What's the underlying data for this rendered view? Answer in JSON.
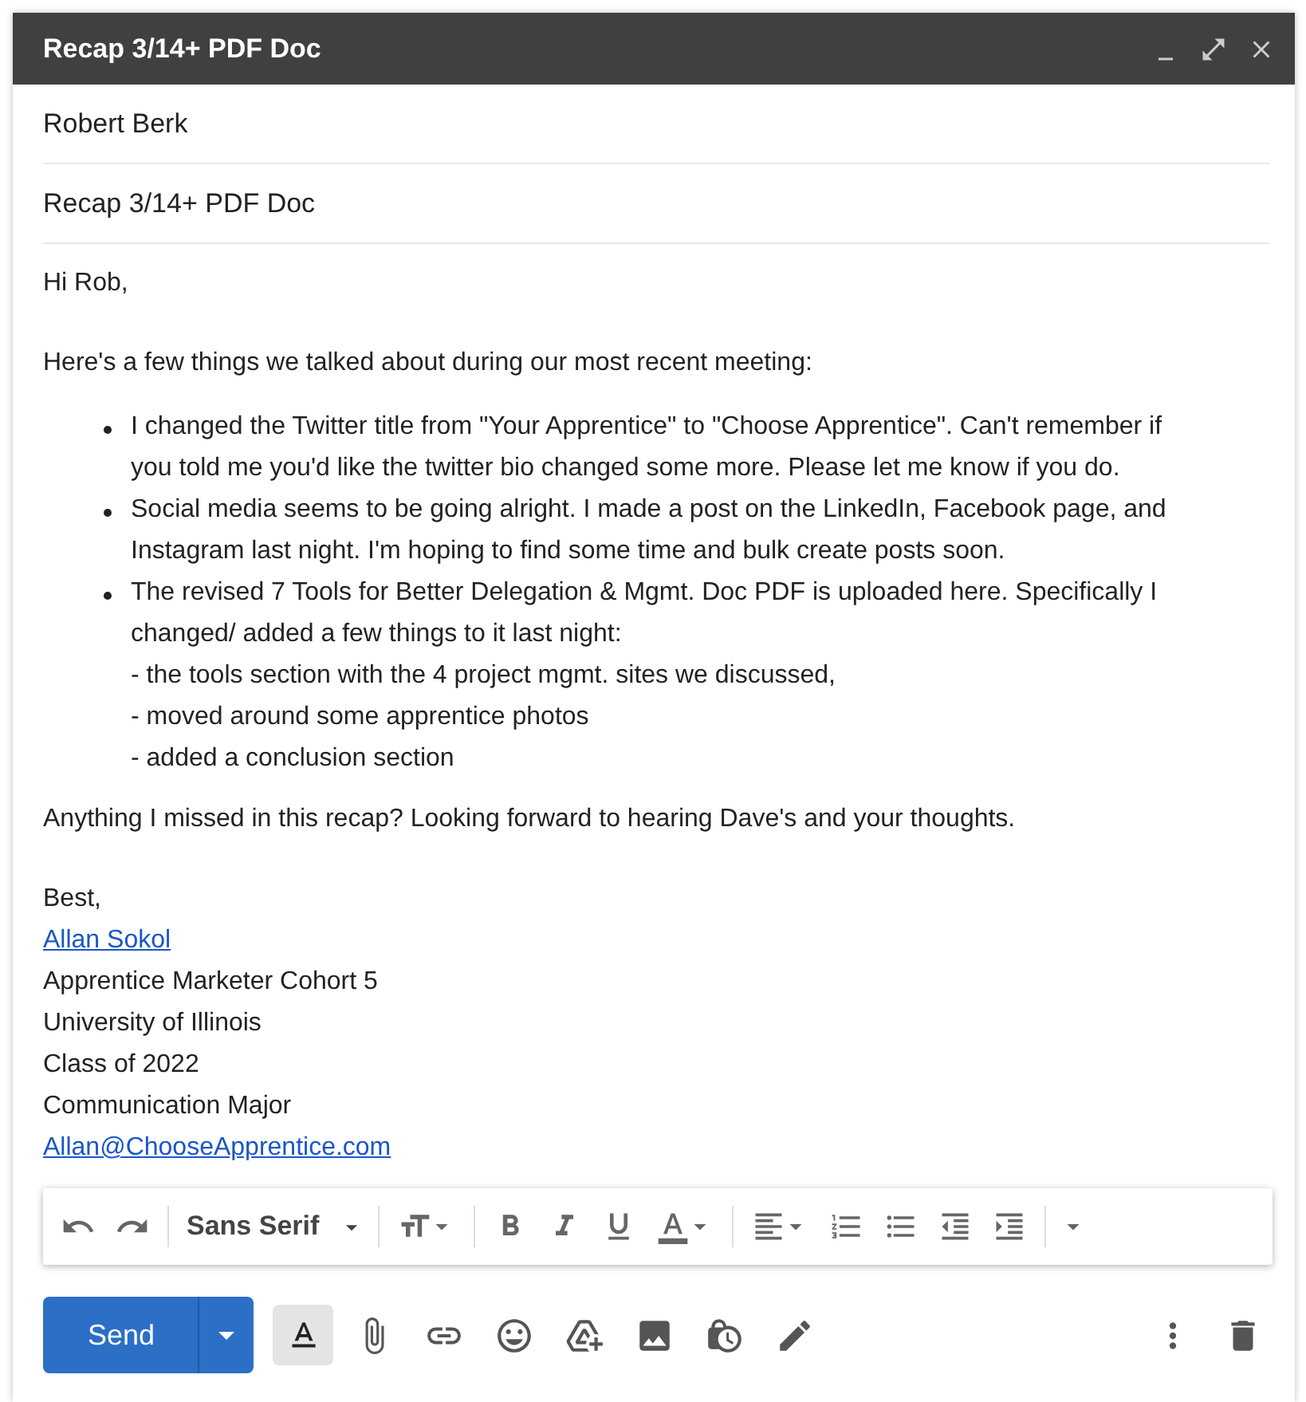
{
  "window": {
    "title": "Recap 3/14+ PDF Doc"
  },
  "recipients": "Robert Berk",
  "subject": "Recap 3/14+ PDF Doc",
  "body": {
    "greeting": "Hi Rob,",
    "intro": "Here's a few things we talked about during our most recent meeting:",
    "bullets": [
      {
        "lines": [
          "I changed the Twitter title from \"Your Apprentice\" to \"Choose Apprentice\". Can't remember if",
          "you told me you'd like the twitter bio changed some more. Please let me know if you do."
        ]
      },
      {
        "lines": [
          "Social media seems to be going alright. I made a post on the LinkedIn, Facebook page, and",
          "Instagram last night. I'm hoping to find some time and bulk create posts soon."
        ]
      },
      {
        "lines": [
          "The revised 7 Tools for Better Delegation & Mgmt. Doc PDF is uploaded here. Specifically I",
          "changed/ added a few things to it last night:",
          "- the tools section with the 4 project mgmt. sites we discussed,",
          "- moved around some apprentice photos",
          "- added a conclusion section"
        ]
      }
    ],
    "closing": "Anything I missed in this recap? Looking forward to hearing Dave's and your thoughts.",
    "signature": [
      {
        "kind": "text",
        "text": "Best,"
      },
      {
        "kind": "link",
        "text": "Allan Sokol"
      },
      {
        "kind": "text",
        "text": "Apprentice Marketer Cohort 5"
      },
      {
        "kind": "text",
        "text": "University of Illinois"
      },
      {
        "kind": "text",
        "text": "Class of 2022"
      },
      {
        "kind": "text",
        "text": "Communication Major"
      },
      {
        "kind": "link",
        "text": "Allan@ChooseApprentice.com"
      }
    ]
  },
  "toolbar": {
    "font": "Sans Serif"
  },
  "bottom_bar": {
    "send_label": "Send",
    "formatting_toggle": {
      "selected": true
    }
  }
}
